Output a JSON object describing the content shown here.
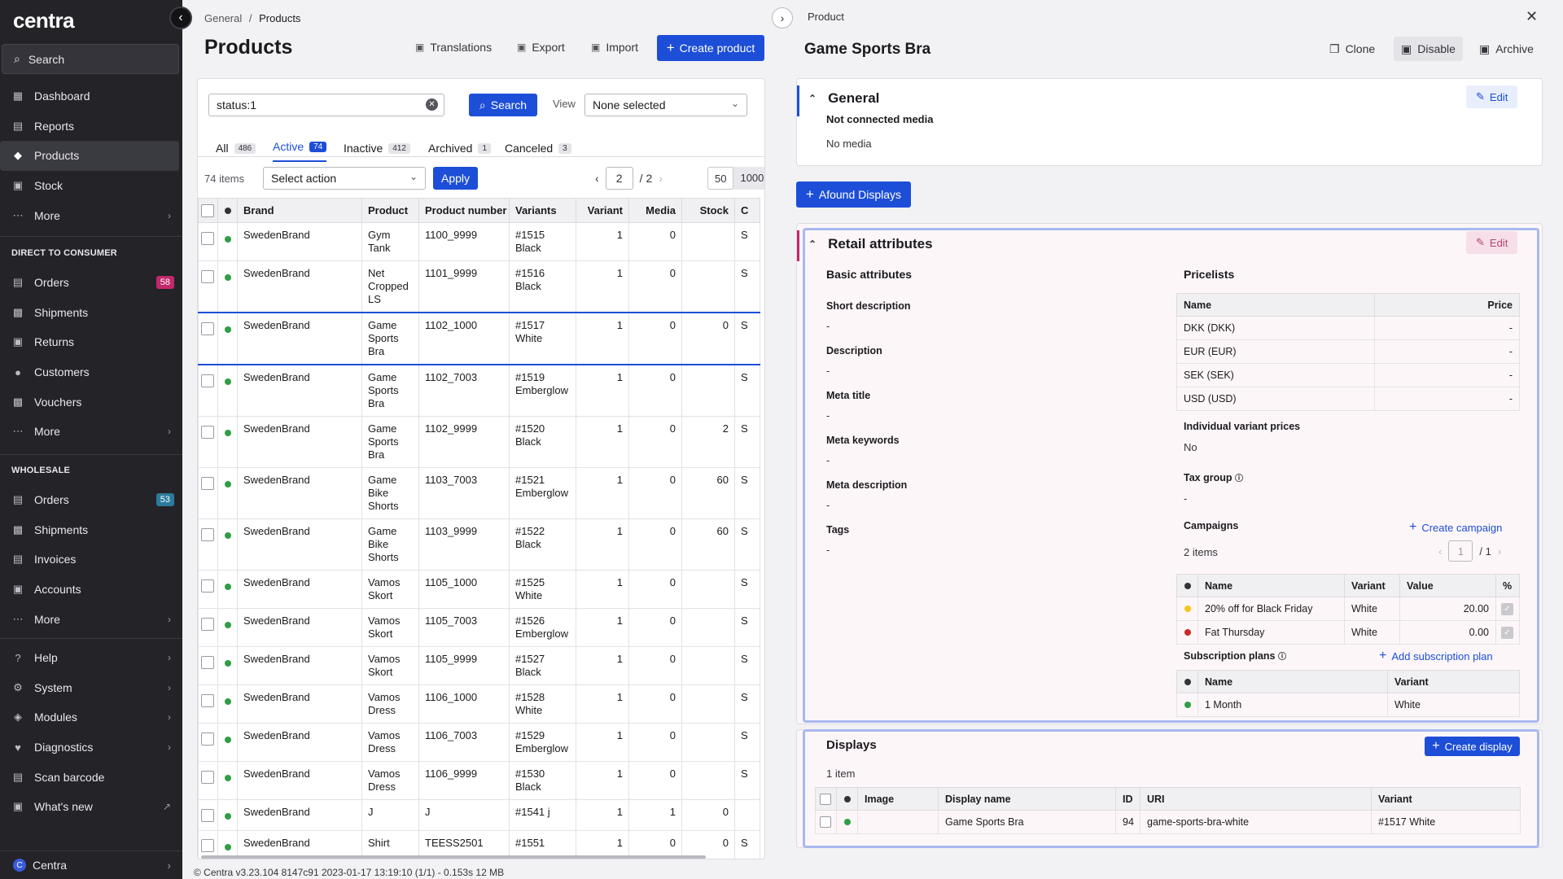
{
  "sidebar": {
    "logo": "centra",
    "search": "Search",
    "main": [
      {
        "label": "Dashboard",
        "icon": "dashboard-icon"
      },
      {
        "label": "Reports",
        "icon": "reports-icon"
      },
      {
        "label": "Products",
        "icon": "tag-icon",
        "active": true
      },
      {
        "label": "Stock",
        "icon": "stock-icon"
      },
      {
        "label": "More",
        "icon": "more-icon"
      }
    ],
    "section_d2c": "DIRECT TO CONSUMER",
    "d2c": [
      {
        "label": "Orders",
        "badge": "58"
      },
      {
        "label": "Shipments"
      },
      {
        "label": "Returns"
      },
      {
        "label": "Customers"
      },
      {
        "label": "Vouchers"
      },
      {
        "label": "More"
      }
    ],
    "section_wholesale": "WHOLESALE",
    "wholesale": [
      {
        "label": "Orders",
        "badge": "53"
      },
      {
        "label": "Shipments"
      },
      {
        "label": "Invoices"
      },
      {
        "label": "Accounts"
      },
      {
        "label": "More"
      }
    ],
    "bottom": [
      {
        "label": "Help"
      },
      {
        "label": "System"
      },
      {
        "label": "Modules"
      },
      {
        "label": "Diagnostics"
      },
      {
        "label": "Scan barcode"
      },
      {
        "label": "What's new"
      }
    ],
    "user": "Centra",
    "user_initial": "C"
  },
  "list": {
    "breadcrumb_root": "General",
    "breadcrumb_sep": "/",
    "breadcrumb_current": "Products",
    "title": "Products",
    "toolbar": {
      "translations": "Translations",
      "export": "Export",
      "import": "Import",
      "create": "Create product"
    },
    "filter_value": "status:1",
    "search_button": "Search",
    "view_label": "View",
    "view_value": "None selected",
    "tabs": [
      {
        "label": "All",
        "count": "486"
      },
      {
        "label": "Active",
        "count": "74"
      },
      {
        "label": "Inactive",
        "count": "412"
      },
      {
        "label": "Archived",
        "count": "1"
      },
      {
        "label": "Canceled",
        "count": "3"
      }
    ],
    "items_count": "74 items",
    "action_placeholder": "Select action",
    "apply": "Apply",
    "page": "2",
    "page_total": "/ 2",
    "per_page": [
      "50",
      "1000"
    ],
    "columns": [
      "Brand",
      "Product",
      "Product number",
      "Variants",
      "Variant",
      "Media",
      "Stock",
      "C"
    ],
    "rows": [
      {
        "brand": "SwedenBrand",
        "product": [
          "Gym",
          "Tank"
        ],
        "number": "1100_9999",
        "variants": [
          "#1515",
          "Black"
        ],
        "variant": "1",
        "media": "0",
        "stock": "",
        "c": "S"
      },
      {
        "brand": "SwedenBrand",
        "product": [
          "Net",
          "Cropped",
          "LS"
        ],
        "number": "1101_9999",
        "variants": [
          "#1516",
          "Black"
        ],
        "variant": "1",
        "media": "0",
        "stock": "",
        "c": "S"
      },
      {
        "brand": "SwedenBrand",
        "product": [
          "Game",
          "Sports",
          "Bra"
        ],
        "number": "1102_1000",
        "variants": [
          "#1517",
          "White"
        ],
        "variant": "1",
        "media": "0",
        "stock": "0",
        "c": "S",
        "selected": true
      },
      {
        "brand": "SwedenBrand",
        "product": [
          "Game",
          "Sports",
          "Bra"
        ],
        "number": "1102_7003",
        "variants": [
          "#1519",
          "Emberglow"
        ],
        "variant": "1",
        "media": "0",
        "stock": "",
        "c": "S"
      },
      {
        "brand": "SwedenBrand",
        "product": [
          "Game",
          "Sports",
          "Bra"
        ],
        "number": "1102_9999",
        "variants": [
          "#1520",
          "Black"
        ],
        "variant": "1",
        "media": "0",
        "stock": "2",
        "c": "S"
      },
      {
        "brand": "SwedenBrand",
        "product": [
          "Game",
          "Bike",
          "Shorts"
        ],
        "number": "1103_7003",
        "variants": [
          "#1521",
          "Emberglow"
        ],
        "variant": "1",
        "media": "0",
        "stock": "60",
        "c": "S"
      },
      {
        "brand": "SwedenBrand",
        "product": [
          "Game",
          "Bike",
          "Shorts"
        ],
        "number": "1103_9999",
        "variants": [
          "#1522",
          "Black"
        ],
        "variant": "1",
        "media": "0",
        "stock": "60",
        "c": "S"
      },
      {
        "brand": "SwedenBrand",
        "product": [
          "Vamos",
          "Skort"
        ],
        "number": "1105_1000",
        "variants": [
          "#1525",
          "White"
        ],
        "variant": "1",
        "media": "0",
        "stock": "",
        "c": "S"
      },
      {
        "brand": "SwedenBrand",
        "product": [
          "Vamos",
          "Skort"
        ],
        "number": "1105_7003",
        "variants": [
          "#1526",
          "Emberglow"
        ],
        "variant": "1",
        "media": "0",
        "stock": "",
        "c": "S"
      },
      {
        "brand": "SwedenBrand",
        "product": [
          "Vamos",
          "Skort"
        ],
        "number": "1105_9999",
        "variants": [
          "#1527",
          "Black"
        ],
        "variant": "1",
        "media": "0",
        "stock": "",
        "c": "S"
      },
      {
        "brand": "SwedenBrand",
        "product": [
          "Vamos",
          "Dress"
        ],
        "number": "1106_1000",
        "variants": [
          "#1528",
          "White"
        ],
        "variant": "1",
        "media": "0",
        "stock": "",
        "c": "S"
      },
      {
        "brand": "SwedenBrand",
        "product": [
          "Vamos",
          "Dress"
        ],
        "number": "1106_7003",
        "variants": [
          "#1529",
          "Emberglow"
        ],
        "variant": "1",
        "media": "0",
        "stock": "",
        "c": "S"
      },
      {
        "brand": "SwedenBrand",
        "product": [
          "Vamos",
          "Dress"
        ],
        "number": "1106_9999",
        "variants": [
          "#1530",
          "Black"
        ],
        "variant": "1",
        "media": "0",
        "stock": "",
        "c": "S"
      },
      {
        "brand": "SwedenBrand",
        "product": [
          "J"
        ],
        "number": "J",
        "variants": [
          "#1541 j"
        ],
        "variant": "1",
        "media": "1",
        "stock": "0",
        "c": ""
      },
      {
        "brand": "SwedenBrand",
        "product": [
          "Shirt"
        ],
        "number": "TEESS2501",
        "variants": [
          "#1551"
        ],
        "variant": "1",
        "media": "0",
        "stock": "0",
        "c": "S"
      }
    ],
    "version": "© Centra v3.23.104 8147c91 2023-01-17 13:19:10 (1/1) - 0.153s 12 MB"
  },
  "detail": {
    "header_label": "Product",
    "title": "Game Sports Bra",
    "actions": {
      "clone": "Clone",
      "disable": "Disable",
      "archive": "Archive"
    },
    "general": {
      "title": "General",
      "edit": "Edit",
      "media_label": "Not connected media",
      "media_value": "No media"
    },
    "afound_button": "Afound Displays",
    "retail": {
      "title": "Retail attributes",
      "edit": "Edit",
      "basic_title": "Basic attributes",
      "fields": [
        {
          "label": "Short description",
          "value": "-"
        },
        {
          "label": "Description",
          "value": "-"
        },
        {
          "label": "Meta title",
          "value": "-"
        },
        {
          "label": "Meta keywords",
          "value": "-"
        },
        {
          "label": "Meta description",
          "value": "-"
        },
        {
          "label": "Tags",
          "value": "-"
        }
      ],
      "pricelists_title": "Pricelists",
      "pricelist_cols": [
        "Name",
        "Price"
      ],
      "pricelists": [
        {
          "name": "DKK (DKK)",
          "price": "-"
        },
        {
          "name": "EUR (EUR)",
          "price": "-"
        },
        {
          "name": "SEK (SEK)",
          "price": "-"
        },
        {
          "name": "USD (USD)",
          "price": "-"
        }
      ],
      "ivp_label": "Individual variant prices",
      "ivp_value": "No",
      "tax_label": "Tax group",
      "tax_value": "-",
      "campaigns_label": "Campaigns",
      "create_campaign": "Create campaign",
      "campaigns_count": "2 items",
      "campaign_page": "1",
      "campaign_total": "/ 1",
      "campaign_cols": [
        "Name",
        "Variant",
        "Value",
        "%"
      ],
      "campaigns": [
        {
          "name": "20% off for Black Friday",
          "variant": "White",
          "value": "20.00",
          "color": "yellow"
        },
        {
          "name": "Fat Thursday",
          "variant": "White",
          "value": "0.00",
          "color": "red"
        }
      ],
      "subs_label": "Subscription plans",
      "add_sub": "Add subscription plan",
      "sub_cols": [
        "Name",
        "Variant"
      ],
      "subs": [
        {
          "name": "1 Month",
          "variant": "White"
        }
      ]
    },
    "displays": {
      "title": "Displays",
      "create": "Create display",
      "count": "1 item",
      "cols": [
        "Image",
        "Display name",
        "ID",
        "URI",
        "Variant"
      ],
      "rows": [
        {
          "image": "",
          "name": "Game Sports Bra",
          "id": "94",
          "uri": "game-sports-bra-white",
          "variant": "#1517 White"
        }
      ]
    }
  }
}
